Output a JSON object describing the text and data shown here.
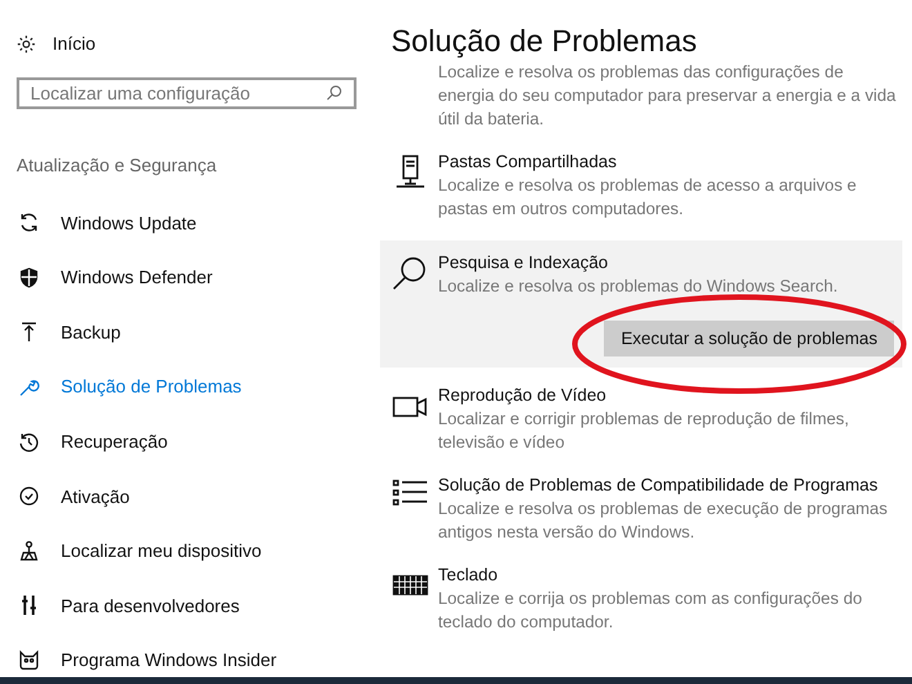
{
  "sidebar": {
    "home": "Início",
    "search": {
      "placeholder": "Localizar uma configuração"
    },
    "section": "Atualização e Segurança",
    "items": [
      {
        "label": "Windows Update",
        "kind": "sync",
        "selected": false
      },
      {
        "label": "Windows Defender",
        "kind": "shield",
        "selected": false
      },
      {
        "label": "Backup",
        "kind": "upload",
        "selected": false
      },
      {
        "label": "Solução de Problemas",
        "kind": "wrench",
        "selected": true
      },
      {
        "label": "Recuperação",
        "kind": "history",
        "selected": false
      },
      {
        "label": "Ativação",
        "kind": "check",
        "selected": false
      },
      {
        "label": "Localizar meu dispositivo",
        "kind": "person",
        "selected": false
      },
      {
        "label": "Para desenvolvedores",
        "kind": "tools",
        "selected": false
      },
      {
        "label": "Programa Windows Insider",
        "kind": "cat",
        "selected": false
      }
    ]
  },
  "main": {
    "title": "Solução de Problemas",
    "items": [
      {
        "kind": "none",
        "description": "Localize e resolva os problemas das configurações de energia do seu computador para preservar a energia e a vida útil da bateria.",
        "expanded": false
      },
      {
        "kind": "server",
        "title": "Pastas Compartilhadas",
        "description": "Localize e resolva os problemas de acesso a arquivos e pastas em outros computadores.",
        "expanded": false
      },
      {
        "kind": "search",
        "title": "Pesquisa e Indexação",
        "description": "Localize e resolva os problemas do Windows Search.",
        "expanded": true,
        "button": "Executar a solução de problemas"
      },
      {
        "kind": "video",
        "title": "Reprodução de Vídeo",
        "description": "Localizar e corrigir problemas de reprodução de filmes, televisão e vídeo",
        "expanded": false
      },
      {
        "kind": "list",
        "title": "Solução de Problemas de Compatibilidade de Programas",
        "description": "Localize e resolva os problemas de execução de programas antigos nesta versão do Windows.",
        "expanded": false
      },
      {
        "kind": "keyboard",
        "title": "Teclado",
        "description": "Localize e corrija os problemas com as configurações do teclado do computador.",
        "expanded": false
      }
    ]
  }
}
